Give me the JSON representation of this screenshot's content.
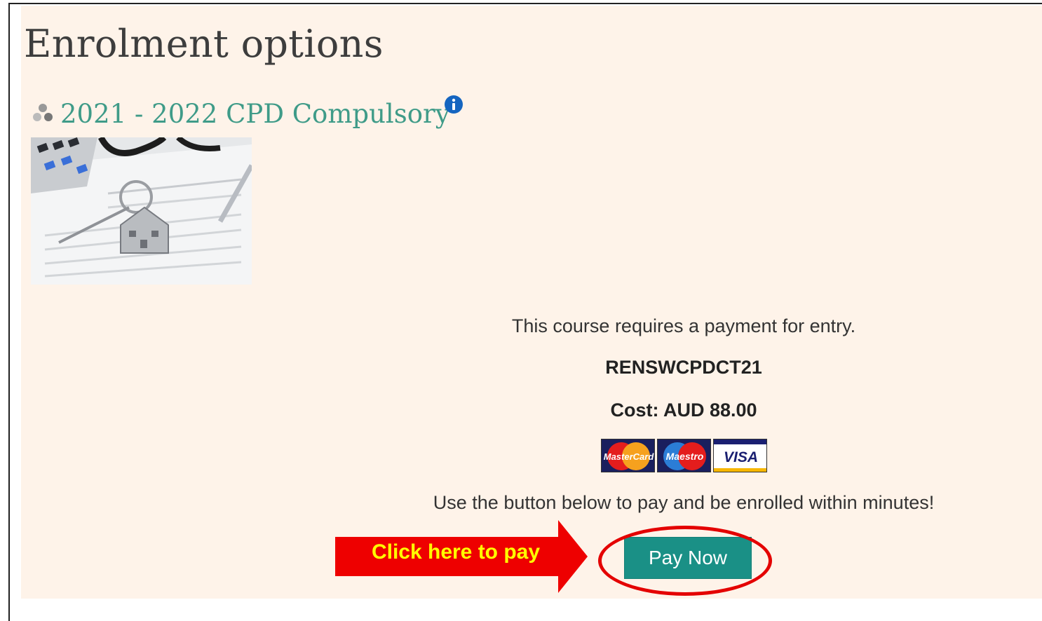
{
  "page": {
    "title": "Enrolment options"
  },
  "course": {
    "name": "2021 - 2022 CPD Compulsory",
    "icon": "course-category-icon",
    "info_icon": "info-icon"
  },
  "payment": {
    "requirement_text": "This course requires a payment for entry.",
    "course_code": "RENSWCPDCT21",
    "cost_text": "Cost: AUD 88.00",
    "accepted_cards": [
      "MasterCard",
      "Maestro",
      "VISA"
    ],
    "instruction_text": "Use the button below to pay and be enrolled within minutes!",
    "pay_button_label": "Pay Now"
  },
  "annotation": {
    "arrow_label": "Click here to pay"
  },
  "colors": {
    "panel_background": "#fef3e9",
    "link": "#3f9b88",
    "button": "#1a9086",
    "annotation_red": "#e40000",
    "annotation_text": "#ffff00"
  }
}
